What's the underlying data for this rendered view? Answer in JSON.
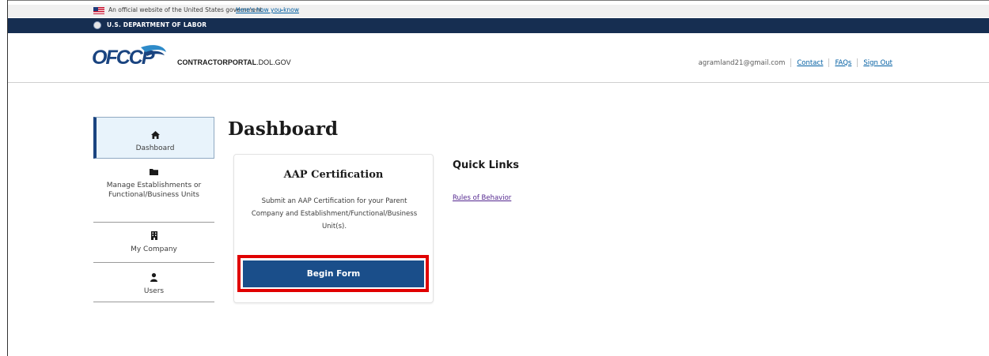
{
  "banner": {
    "official_text": "An official website of the United States government.",
    "how_know_link": "Here's how you know",
    "chevron": "⌄"
  },
  "agency_bar": {
    "name": "U.S. DEPARTMENT OF LABOR"
  },
  "header": {
    "logo_text": "OFCCP",
    "portal_bold": "CONTRACTORPORTAL",
    "portal_rest": ".DOL.GOV",
    "user_email": "agramland21@gmail.com",
    "contact_label": "Contact",
    "faqs_label": "FAQs",
    "signout_label": "Sign Out"
  },
  "sidebar": {
    "items": [
      {
        "label": "Dashboard",
        "icon": "home-icon",
        "active": true
      },
      {
        "label": "Manage Establishments or Functional/Business Units",
        "icon": "folder-icon"
      },
      {
        "label": "My Company",
        "icon": "building-icon"
      },
      {
        "label": "Users",
        "icon": "user-icon"
      }
    ]
  },
  "main": {
    "title": "Dashboard",
    "card": {
      "title": "AAP Certification",
      "description": "Submit an AAP Certification for your Parent Company and Establishment/Functional/Business Unit(s).",
      "button_label": "Begin Form"
    },
    "quick_links": {
      "title": "Quick Links",
      "links": [
        {
          "label": "Rules of Behavior"
        }
      ]
    }
  },
  "colors": {
    "agency_bar": "#162e51",
    "primary_button": "#1a4e8a",
    "highlight_border": "#e00000",
    "link": "#005ea2",
    "visited_link": "#54278f"
  }
}
